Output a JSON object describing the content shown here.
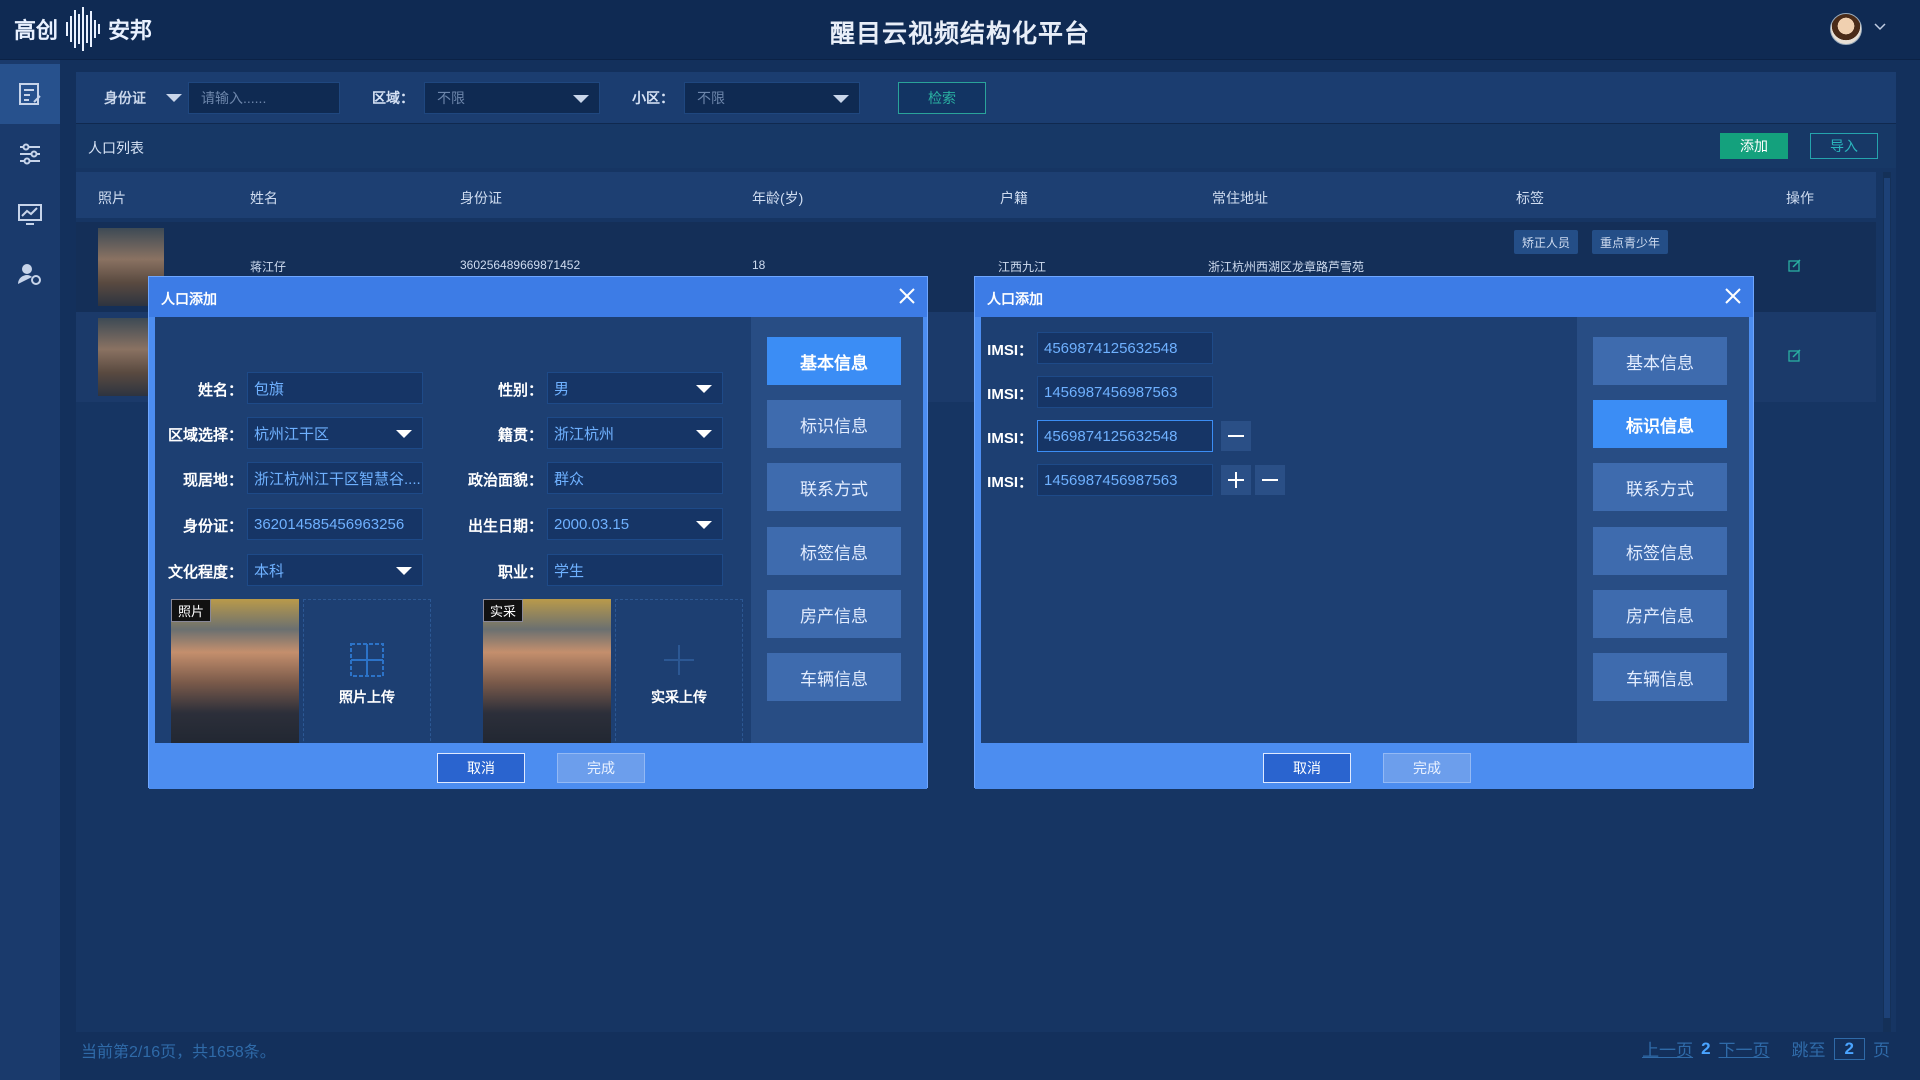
{
  "app": {
    "logo_text_left": "高创",
    "logo_text_right": "安邦",
    "title": "醒目云视频结构化平台"
  },
  "filter": {
    "id_type": "身份证",
    "id_placeholder": "请输入......",
    "area_label": "区域：",
    "area_value": "不限",
    "community_label": "小区：",
    "community_value": "不限",
    "search": "检索"
  },
  "list": {
    "title": "人口列表",
    "add": "添加",
    "import": "导入"
  },
  "table": {
    "headers": [
      "照片",
      "姓名",
      "身份证",
      "年龄(岁)",
      "户籍",
      "常住地址",
      "标签",
      "操作"
    ],
    "rows": [
      {
        "name": "蒋江仔",
        "id": "360256489669871452",
        "age": "18",
        "hukou": "江西九江",
        "address": "浙江杭州西湖区龙章路芦雪苑",
        "tags": [
          "矫正人员",
          "重点青少年"
        ]
      }
    ]
  },
  "footer": {
    "summary": "当前第2/16页，共1658条。",
    "prev": "上一页",
    "page": "2",
    "next": "下一页",
    "goto": "跳至",
    "goto_page": "2",
    "page_unit": "页"
  },
  "modal_left": {
    "title": "人口添加",
    "fields": {
      "name_label": "姓名：",
      "name": "包旗",
      "gender_label": "性别：",
      "gender": "男",
      "region_label": "区域选择：",
      "region": "杭州江干区",
      "native_label": "籍贯：",
      "native": "浙江杭州",
      "residence_label": "现居地：",
      "residence": "浙江杭州江干区智慧谷.....",
      "politics_label": "政治面貌：",
      "politics": "群众",
      "idcard_label": "身份证：",
      "idcard": "362014585456963256",
      "birth_label": "出生日期：",
      "birth": "2000.03.15",
      "edu_label": "文化程度：",
      "edu": "本科",
      "job_label": "职业：",
      "job": "学生"
    },
    "photo_tag": "照片",
    "photo_upload": "照片上传",
    "capture_tag": "实采",
    "capture_upload": "实采上传",
    "cancel": "取消",
    "done": "完成"
  },
  "modal_right": {
    "title": "人口添加",
    "imsi_label": "IMSI：",
    "imsi": [
      "4569874125632548",
      "1456987456987563",
      "4569874125632548",
      "1456987456987563"
    ],
    "cancel": "取消",
    "done": "完成"
  },
  "side_tabs": [
    "基本信息",
    "标识信息",
    "联系方式",
    "标签信息",
    "房产信息",
    "车辆信息"
  ]
}
